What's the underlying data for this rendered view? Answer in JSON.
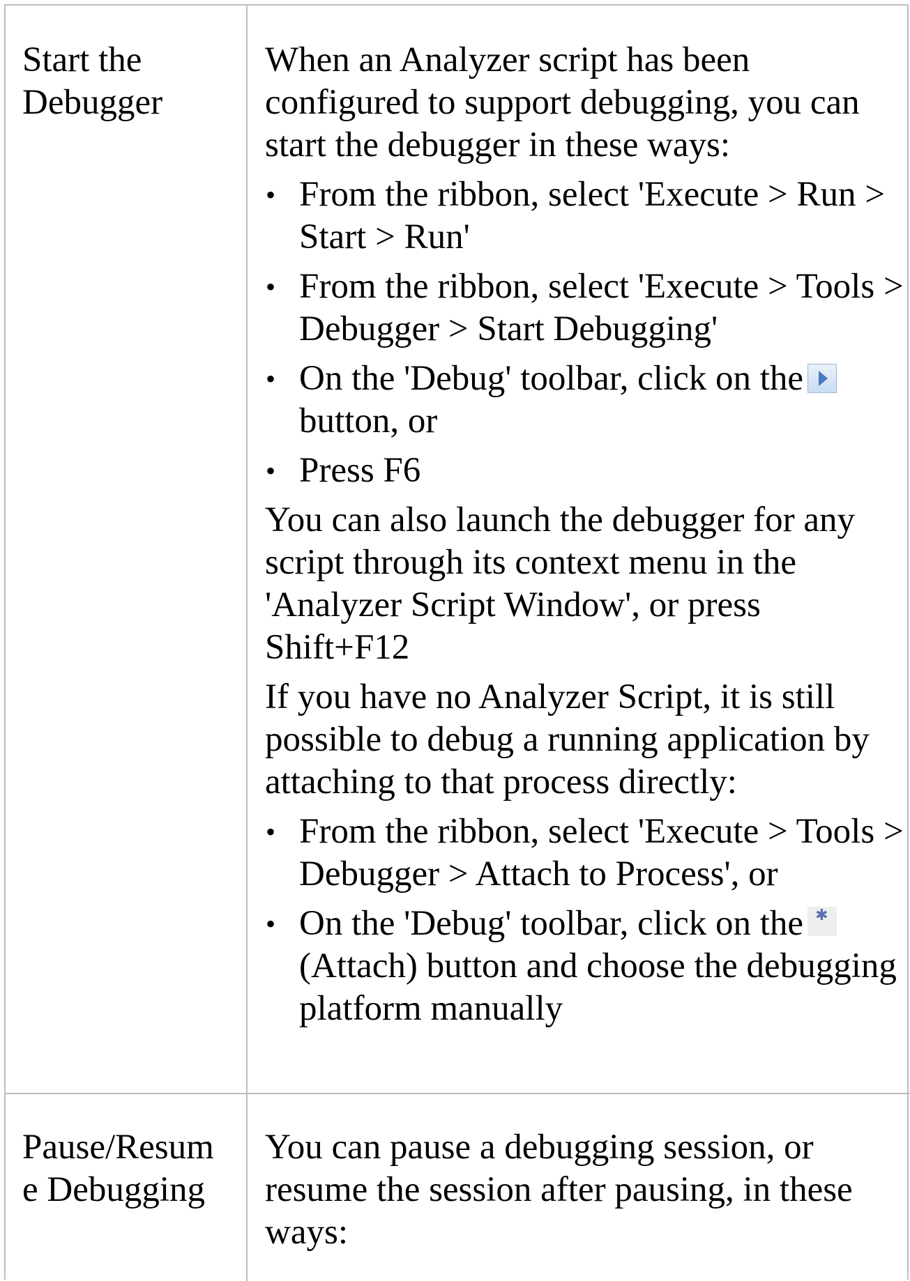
{
  "rows": [
    {
      "label_lines": [
        "Start the",
        "Debugger"
      ],
      "intro": "When an Analyzer script has been configured to support debugging, you can start the debugger in these ways:",
      "bullets1": [
        "From the ribbon, select 'Execute > Run > Start > Run'",
        "From the ribbon, select 'Execute > Tools > Debugger > Start Debugging'",
        {
          "before": "On the 'Debug' toolbar, click on the",
          "icon": "run-debug-icon",
          "after": "button, or"
        },
        "Press F6"
      ],
      "para2": "You can also launch the debugger for any script through its context menu in the 'Analyzer Script Window', or press Shift+F12",
      "para3": "If you have no Analyzer Script, it is still possible to debug a running application by attaching to that process directly:",
      "bullets2": [
        "From the ribbon, select 'Execute > Tools > Debugger > Attach to Process', or",
        {
          "before": "On the 'Debug' toolbar, click on the",
          "icon": "attach-gear-icon",
          "after": "(Attach) button and choose the debugging platform manually"
        }
      ]
    },
    {
      "label_lines": [
        "Pause/Resum",
        "e Debugging"
      ],
      "intro": "You can pause a debugging session, or resume the session after pausing, in these ways:"
    }
  ],
  "colors": {
    "border": "#bdbdbd",
    "text": "#000000"
  }
}
